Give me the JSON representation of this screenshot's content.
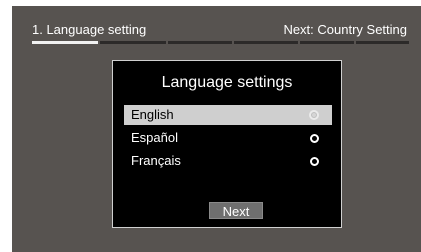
{
  "header": {
    "current_step": "1. Language setting",
    "next_step": "Next: Country Setting"
  },
  "progress": {
    "total_steps": 6,
    "current_step": 1
  },
  "dialog": {
    "title": "Language settings",
    "languages": [
      {
        "label": "English",
        "selected": true
      },
      {
        "label": "Español",
        "selected": false
      },
      {
        "label": "Français",
        "selected": false
      }
    ],
    "next_label": "Next"
  },
  "colors": {
    "screen_background": "#575350",
    "dialog_background": "#000000",
    "selection_highlight": "#cfcfcf",
    "button_background": "#6f6f6f",
    "progress_active": "#f2f2f2",
    "progress_inactive": "#2c2a29"
  }
}
